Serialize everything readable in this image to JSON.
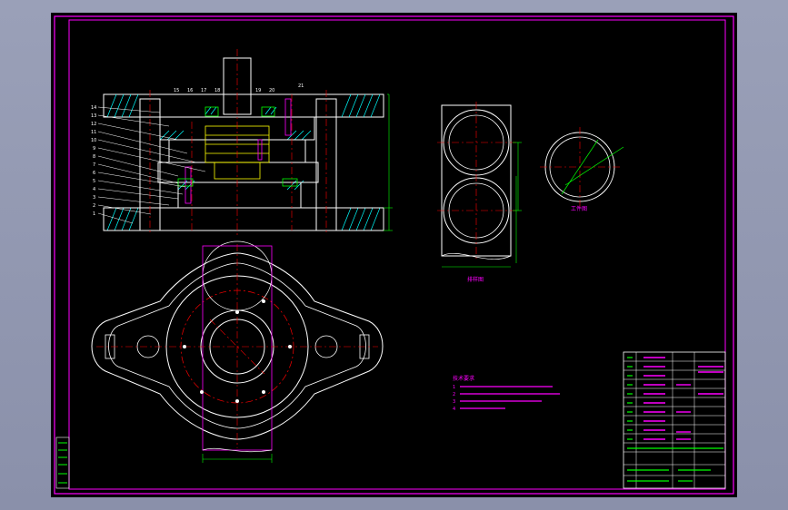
{
  "colors": {
    "background_outer": "#9099b0",
    "canvas": "#000000",
    "frame": "#ff00ff",
    "geometry": "#ffffff",
    "centerline": "#ff0000",
    "hatch": "#00ffff",
    "section": "#ffff00",
    "dimension": "#00ff00",
    "notes": "#ff00ff"
  },
  "views": {
    "section_view": "section",
    "plan_view": "plan",
    "strip_layout": "strip-layout",
    "blank_part": "blank-part"
  },
  "labels": {
    "blank_caption": "工件图",
    "strip_caption": "排样图",
    "balloons_left": [
      "14",
      "13",
      "12",
      "11",
      "10",
      "9",
      "8",
      "7",
      "6",
      "5",
      "4",
      "3",
      "2",
      "1"
    ],
    "balloons_top": [
      "15",
      "16",
      "17",
      "18",
      "19",
      "20",
      "21"
    ],
    "tech_title": "技术要求",
    "tech_notes": [
      "1",
      "2",
      "3",
      "4"
    ]
  },
  "title_block": {
    "rows": 14,
    "cols": 4
  }
}
